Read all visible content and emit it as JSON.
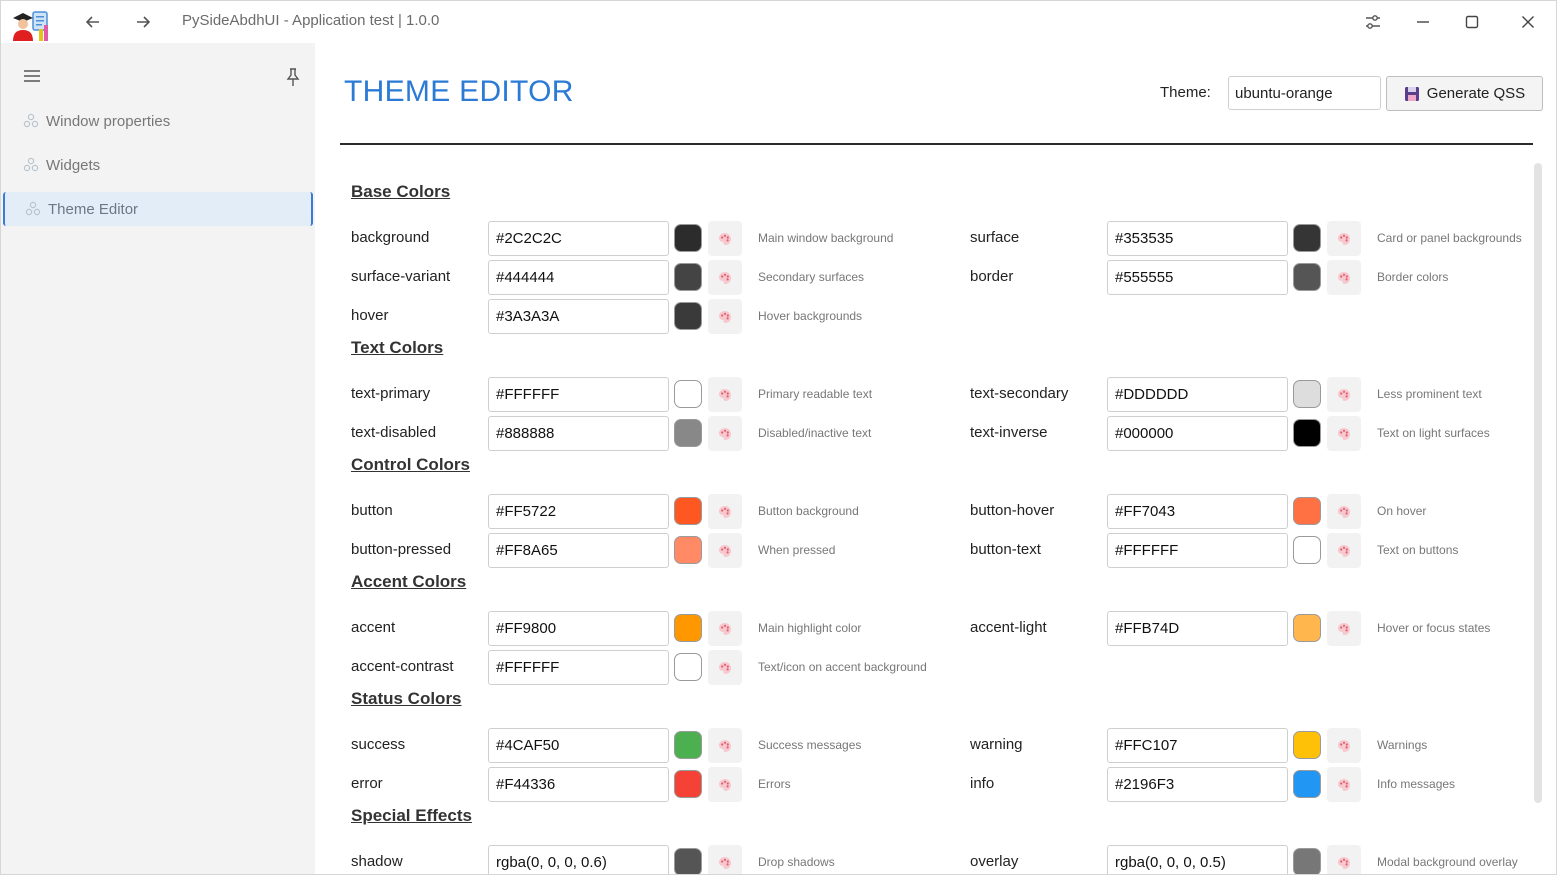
{
  "window": {
    "title": "PySideAbdhUI - Application test | 1.0.0"
  },
  "sidebar": {
    "items": [
      {
        "label": "Window properties",
        "active": false
      },
      {
        "label": "Widgets",
        "active": false
      },
      {
        "label": "Theme Editor",
        "active": true
      }
    ]
  },
  "header": {
    "page_title": "THEME EDITOR",
    "theme_label": "Theme:",
    "theme_value": "ubuntu-orange",
    "generate_label": "Generate QSS"
  },
  "accent_color": "#2a7ad6",
  "sections": [
    {
      "title": "Base Colors",
      "rows": [
        {
          "left": {
            "name": "background",
            "hex": "#2C2C2C",
            "swatch": "#2C2C2C",
            "desc": "Main window background"
          },
          "right": {
            "name": "surface",
            "hex": "#353535",
            "swatch": "#353535",
            "desc": "Card or panel backgrounds"
          }
        },
        {
          "left": {
            "name": "surface-variant",
            "hex": "#444444",
            "swatch": "#444444",
            "desc": "Secondary surfaces"
          },
          "right": {
            "name": "border",
            "hex": "#555555",
            "swatch": "#555555",
            "desc": "Border colors"
          }
        },
        {
          "left": {
            "name": "hover",
            "hex": "#3A3A3A",
            "swatch": "#3A3A3A",
            "desc": "Hover backgrounds"
          }
        }
      ]
    },
    {
      "title": "Text Colors",
      "rows": [
        {
          "left": {
            "name": "text-primary",
            "hex": "#FFFFFF",
            "swatch": "#FFFFFF",
            "desc": "Primary readable text"
          },
          "right": {
            "name": "text-secondary",
            "hex": "#DDDDDD",
            "swatch": "#DDDDDD",
            "desc": "Less prominent text"
          }
        },
        {
          "left": {
            "name": "text-disabled",
            "hex": "#888888",
            "swatch": "#888888",
            "desc": "Disabled/inactive text"
          },
          "right": {
            "name": "text-inverse",
            "hex": "#000000",
            "swatch": "#000000",
            "desc": "Text on light surfaces"
          }
        }
      ]
    },
    {
      "title": "Control Colors",
      "rows": [
        {
          "left": {
            "name": "button",
            "hex": "#FF5722",
            "swatch": "#FF5722",
            "desc": "Button background"
          },
          "right": {
            "name": "button-hover",
            "hex": "#FF7043",
            "swatch": "#FF7043",
            "desc": "On hover"
          }
        },
        {
          "left": {
            "name": "button-pressed",
            "hex": "#FF8A65",
            "swatch": "#FF8A65",
            "desc": "When pressed"
          },
          "right": {
            "name": "button-text",
            "hex": "#FFFFFF",
            "swatch": "#FFFFFF",
            "desc": "Text on buttons"
          }
        }
      ]
    },
    {
      "title": "Accent Colors",
      "rows": [
        {
          "left": {
            "name": "accent",
            "hex": "#FF9800",
            "swatch": "#FF9800",
            "desc": "Main highlight color"
          },
          "right": {
            "name": "accent-light",
            "hex": "#FFB74D",
            "swatch": "#FFB74D",
            "desc": "Hover or focus states"
          }
        },
        {
          "left": {
            "name": "accent-contrast",
            "hex": "#FFFFFF",
            "swatch": "#FFFFFF",
            "desc": "Text/icon on accent background"
          }
        }
      ]
    },
    {
      "title": "Status Colors",
      "rows": [
        {
          "left": {
            "name": "success",
            "hex": "#4CAF50",
            "swatch": "#4CAF50",
            "desc": "Success messages"
          },
          "right": {
            "name": "warning",
            "hex": "#FFC107",
            "swatch": "#FFC107",
            "desc": "Warnings"
          }
        },
        {
          "left": {
            "name": "error",
            "hex": "#F44336",
            "swatch": "#F44336",
            "desc": "Errors"
          },
          "right": {
            "name": "info",
            "hex": "#2196F3",
            "swatch": "#2196F3",
            "desc": "Info messages"
          }
        }
      ]
    },
    {
      "title": "Special Effects",
      "rows": [
        {
          "left": {
            "name": "shadow",
            "hex": "rgba(0, 0, 0, 0.6)",
            "swatch": "#555555",
            "desc": "Drop shadows"
          },
          "right": {
            "name": "overlay",
            "hex": "rgba(0, 0, 0, 0.5)",
            "swatch": "#777777",
            "desc": "Modal background overlay"
          }
        }
      ]
    }
  ]
}
